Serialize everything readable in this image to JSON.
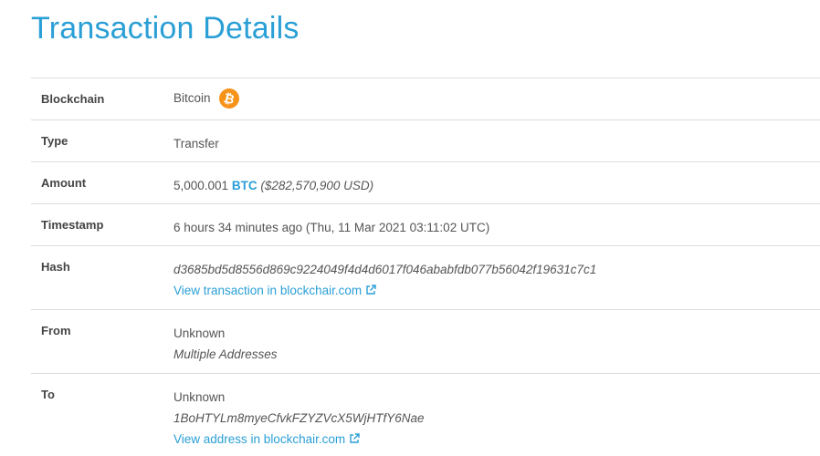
{
  "page": {
    "title": "Transaction Details"
  },
  "rows": {
    "blockchain": {
      "label": "Blockchain",
      "value": "Bitcoin",
      "icon": "bitcoin-icon",
      "icon_glyph": "₿",
      "icon_color": "#f7931a"
    },
    "type": {
      "label": "Type",
      "value": "Transfer"
    },
    "amount": {
      "label": "Amount",
      "value": "5,000.001",
      "ticker": "BTC",
      "usd": "($282,570,900 USD)"
    },
    "timestamp": {
      "label": "Timestamp",
      "value": "6 hours 34 minutes ago (Thu, 11 Mar 2021 03:11:02 UTC)"
    },
    "hash": {
      "label": "Hash",
      "value": "d3685bd5d8556d869c9224049f4d4d6017f046ababfdb077b56042f19631c7c1",
      "link": "View transaction in blockchair.com"
    },
    "from": {
      "label": "From",
      "value": "Unknown",
      "detail": "Multiple Addresses"
    },
    "to": {
      "label": "To",
      "value": "Unknown",
      "address": "1BoHTYLm8myeCfvkFZYZVcX5WjHTfY6Nae",
      "link": "View address in blockchair.com"
    }
  },
  "colors": {
    "accent": "#2a9fd6",
    "label": "#444444",
    "text": "#555555",
    "divider": "#dddddd",
    "bitcoin": "#f7931a"
  }
}
